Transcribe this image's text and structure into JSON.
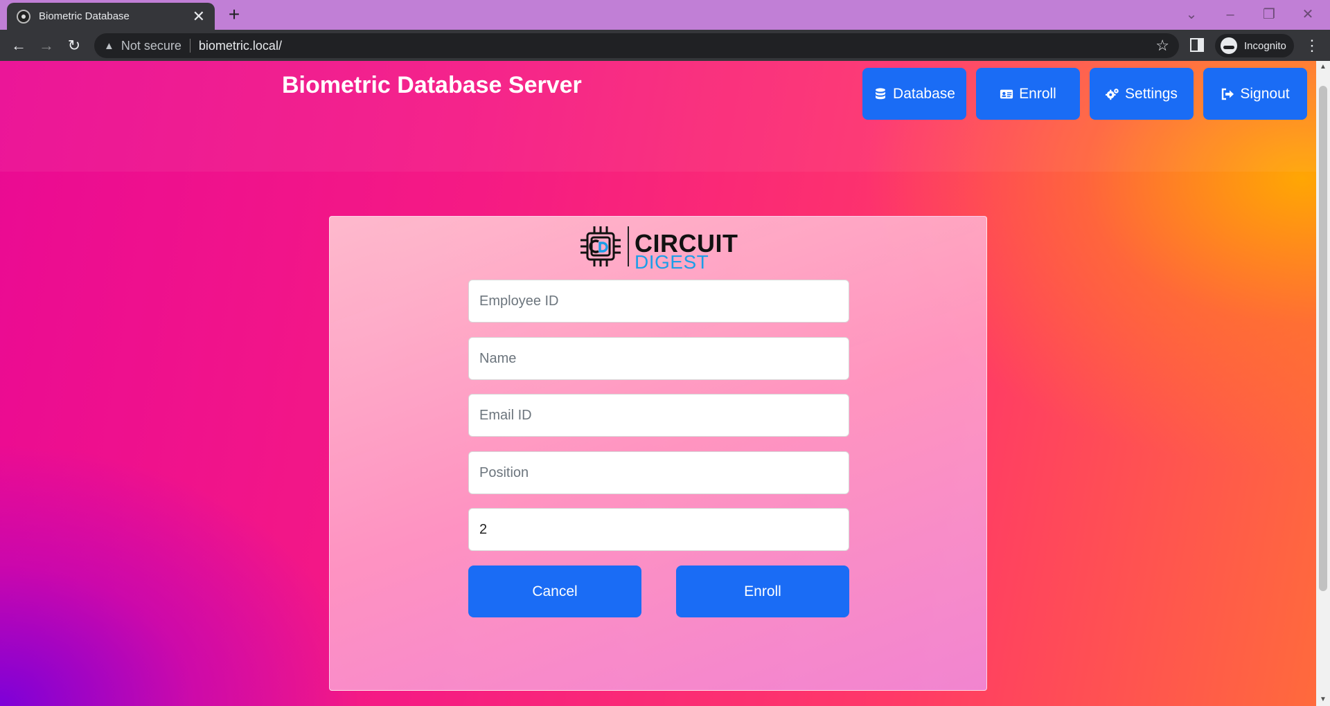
{
  "browser": {
    "tab_title": "Biometric Database",
    "tab_close": "✕",
    "new_tab": "+",
    "not_secure": "Not secure",
    "url": "biometric.local/",
    "profile_label": "Incognito",
    "icons": {
      "back": "arrow-left-icon",
      "forward": "arrow-right-icon",
      "reload": "reload-icon",
      "warning": "warning-icon",
      "bookmark": "star-icon",
      "menu": "kebab-icon"
    }
  },
  "header": {
    "title": "Biometric Database Server",
    "nav": [
      {
        "label": "Database",
        "icon": "database-icon"
      },
      {
        "label": "Enroll",
        "icon": "id-card-icon"
      },
      {
        "label": "Settings",
        "icon": "gears-icon"
      },
      {
        "label": "Signout",
        "icon": "sign-out-icon"
      }
    ]
  },
  "logo": {
    "line1": "CIRCUIT",
    "line2": "DIGEST"
  },
  "form": {
    "employee_id_placeholder": "Employee ID",
    "name_placeholder": "Name",
    "email_placeholder": "Email ID",
    "position_placeholder": "Position",
    "fingerprint_id_value": "2",
    "cancel_label": "Cancel",
    "enroll_label": "Enroll"
  },
  "colors": {
    "button_blue": "#1a6cf5",
    "logo_blue": "#1b9ee8"
  }
}
